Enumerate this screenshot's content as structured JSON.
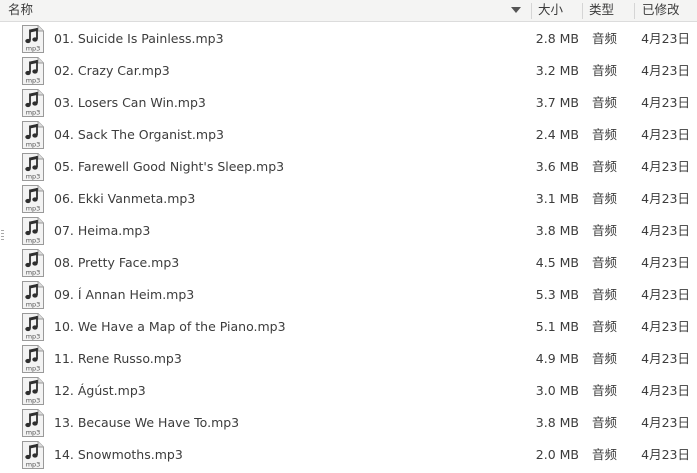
{
  "columns": {
    "name": "名称",
    "size": "大小",
    "type": "类型",
    "modified": "已修改"
  },
  "sort": {
    "column": "name",
    "direction": "descending",
    "icon": "sort-down-arrow"
  },
  "file_icon": {
    "name": "audio-mp3-icon",
    "label": "mp3"
  },
  "files": [
    {
      "name": "01. Suicide Is Painless.mp3",
      "size": "2.8 MB",
      "type": "音频",
      "modified": "4月23日"
    },
    {
      "name": "02. Crazy Car.mp3",
      "size": "3.2 MB",
      "type": "音频",
      "modified": "4月23日"
    },
    {
      "name": "03. Losers Can Win.mp3",
      "size": "3.7 MB",
      "type": "音频",
      "modified": "4月23日"
    },
    {
      "name": "04. Sack The Organist.mp3",
      "size": "2.4 MB",
      "type": "音频",
      "modified": "4月23日"
    },
    {
      "name": "05. Farewell Good Night's Sleep.mp3",
      "size": "3.6 MB",
      "type": "音频",
      "modified": "4月23日"
    },
    {
      "name": "06. Ekki Vanmeta.mp3",
      "size": "3.1 MB",
      "type": "音频",
      "modified": "4月23日"
    },
    {
      "name": "07. Heima.mp3",
      "size": "3.8 MB",
      "type": "音频",
      "modified": "4月23日"
    },
    {
      "name": "08. Pretty Face.mp3",
      "size": "4.5 MB",
      "type": "音频",
      "modified": "4月23日"
    },
    {
      "name": "09. Í Annan Heim.mp3",
      "size": "5.3 MB",
      "type": "音频",
      "modified": "4月23日"
    },
    {
      "name": "10. We Have a Map of the Piano.mp3",
      "size": "5.1 MB",
      "type": "音频",
      "modified": "4月23日"
    },
    {
      "name": "11. Rene Russo.mp3",
      "size": "4.9 MB",
      "type": "音频",
      "modified": "4月23日"
    },
    {
      "name": "12. Ágúst.mp3",
      "size": "3.0 MB",
      "type": "音频",
      "modified": "4月23日"
    },
    {
      "name": "13. Because We Have To.mp3",
      "size": "3.8 MB",
      "type": "音频",
      "modified": "4月23日"
    },
    {
      "name": "14. Snowmoths.mp3",
      "size": "2.0 MB",
      "type": "音频",
      "modified": "4月23日"
    }
  ]
}
